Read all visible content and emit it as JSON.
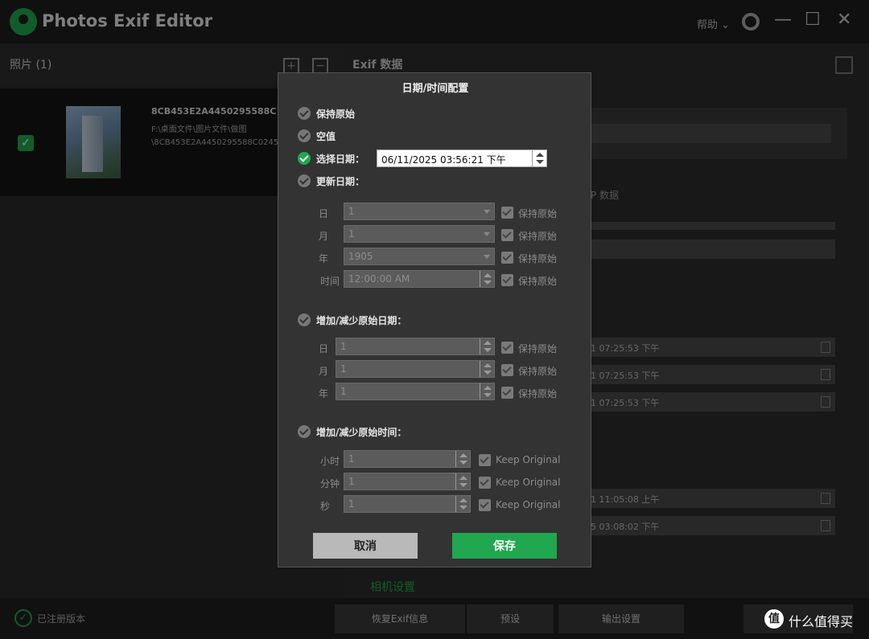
{
  "app": {
    "title": "Photos Exif Editor",
    "help": "帮助 ⌄",
    "window": {
      "minimize": "—",
      "maximize": "☐",
      "close": "✕"
    }
  },
  "left": {
    "header": "照片 (1)",
    "photo": {
      "name": "8CB453E2A4450295588C",
      "path": "F:\\桌面文件\\图片文件\\做图\\8CB453E2A4450295588C0245.jpg"
    }
  },
  "right": {
    "title": "Exif 数据",
    "tab_partial": "P 数据",
    "dates": [
      "1 07:25:53 下午",
      "1 07:25:53 下午",
      "1 07:25:53 下午",
      "1 11:05:08 上午",
      "5 03:08:02 下午"
    ],
    "camera_link": "相机设置"
  },
  "bottom": {
    "status": "已注册版本",
    "buttons": [
      "恢复Exif信息",
      "预设",
      "输出设置"
    ],
    "watermark": "什么值得买"
  },
  "dialog": {
    "title": "日期/时间配置",
    "options": {
      "keep": "保持原始",
      "empty": "空值",
      "choose": "选择日期：",
      "update": "更新日期：",
      "shift_date": "增加/减少原始日期：",
      "shift_time": "增加/减少原始时间："
    },
    "chosen_date": "06/11/2025 03:56:21 下午",
    "update_rows": [
      {
        "label": "日",
        "value": "1",
        "keep": "保持原始"
      },
      {
        "label": "月",
        "value": "1",
        "keep": "保持原始"
      },
      {
        "label": "年",
        "value": "1905",
        "keep": "保持原始"
      },
      {
        "label": "时间",
        "value": "12:00:00 AM",
        "keep": "保持原始"
      }
    ],
    "shift_date_rows": [
      {
        "label": "日",
        "value": "1",
        "keep": "保持原始"
      },
      {
        "label": "月",
        "value": "1",
        "keep": "保持原始"
      },
      {
        "label": "年",
        "value": "1",
        "keep": "保持原始"
      }
    ],
    "shift_time_rows": [
      {
        "label": "小时",
        "value": "1",
        "keep": "Keep Original"
      },
      {
        "label": "分钟",
        "value": "1",
        "keep": "Keep Original"
      },
      {
        "label": "秒",
        "value": "1",
        "keep": "Keep Original"
      }
    ],
    "cancel": "取消",
    "save": "保存"
  },
  "colors": {
    "accent": "#1fa84f",
    "dialog_bg": "#333333",
    "disabled_field": "#5b5b5b"
  }
}
